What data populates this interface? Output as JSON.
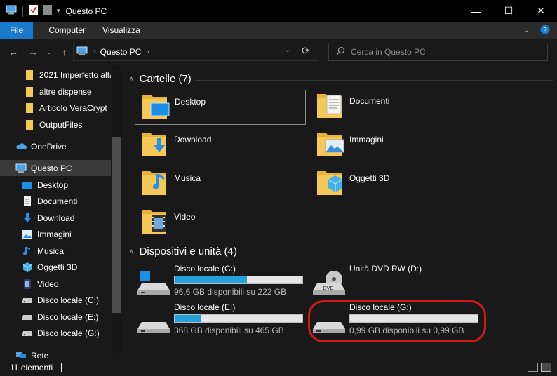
{
  "window": {
    "title": "Questo PC",
    "controls": {
      "minimize": "—",
      "maximize": "☐",
      "close": "✕"
    }
  },
  "ribbon": {
    "tabs": [
      "File",
      "Computer",
      "Visualizza"
    ]
  },
  "address": {
    "path": "Questo PC",
    "search_placeholder": "Cerca in Questo PC"
  },
  "sidebar": {
    "items": [
      {
        "label": "2021 Imperfetto alta",
        "icon": "folder-icon"
      },
      {
        "label": "altre dispense",
        "icon": "folder-icon"
      },
      {
        "label": "Articolo VeraCrypt",
        "icon": "folder-icon"
      },
      {
        "label": "OutputFiles",
        "icon": "folder-icon"
      },
      {
        "label": "OneDrive",
        "icon": "cloud-icon"
      },
      {
        "label": "Questo PC",
        "icon": "computer-icon"
      },
      {
        "label": "Desktop",
        "icon": "desktop-icon"
      },
      {
        "label": "Documenti",
        "icon": "document-icon"
      },
      {
        "label": "Download",
        "icon": "download-icon"
      },
      {
        "label": "Immagini",
        "icon": "image-icon"
      },
      {
        "label": "Musica",
        "icon": "music-icon"
      },
      {
        "label": "Oggetti 3D",
        "icon": "cube-icon"
      },
      {
        "label": "Video",
        "icon": "video-icon"
      },
      {
        "label": "Disco locale (C:)",
        "icon": "drive-icon"
      },
      {
        "label": "Disco locale (E:)",
        "icon": "drive-icon"
      },
      {
        "label": "Disco locale (G:)",
        "icon": "drive-icon"
      },
      {
        "label": "Rete",
        "icon": "network-icon"
      }
    ]
  },
  "folders": {
    "header": "Cartelle (7)",
    "items": [
      {
        "label": "Desktop",
        "icon": "desktop-folder-icon"
      },
      {
        "label": "Documenti",
        "icon": "documents-folder-icon"
      },
      {
        "label": "Download",
        "icon": "download-folder-icon"
      },
      {
        "label": "Immagini",
        "icon": "pictures-folder-icon"
      },
      {
        "label": "Musica",
        "icon": "music-folder-icon"
      },
      {
        "label": "Oggetti 3D",
        "icon": "3d-objects-folder-icon"
      },
      {
        "label": "Video",
        "icon": "video-folder-icon"
      }
    ]
  },
  "devices": {
    "header": "Dispositivi e unità (4)",
    "items": [
      {
        "name": "Disco locale (C:)",
        "free": "96,6 GB disponibili su 222 GB",
        "used_fraction": 0.565,
        "icon": "windows-drive-icon"
      },
      {
        "name": "Unità DVD RW (D:)",
        "free": "",
        "icon": "dvd-drive-icon"
      },
      {
        "name": "Disco locale (E:)",
        "free": "368 GB disponibili su 465 GB",
        "used_fraction": 0.209,
        "icon": "drive-icon"
      },
      {
        "name": "Disco locale (G:)",
        "free": "0,99 GB disponibili su 0,99 GB",
        "used_fraction": 0.0,
        "icon": "drive-icon"
      }
    ]
  },
  "status": {
    "count": "11 elementi"
  },
  "colors": {
    "accent": "#1979ca",
    "drive_bar": "#26a0da",
    "highlight": "#d21a1a",
    "folder": "#f6c858"
  }
}
